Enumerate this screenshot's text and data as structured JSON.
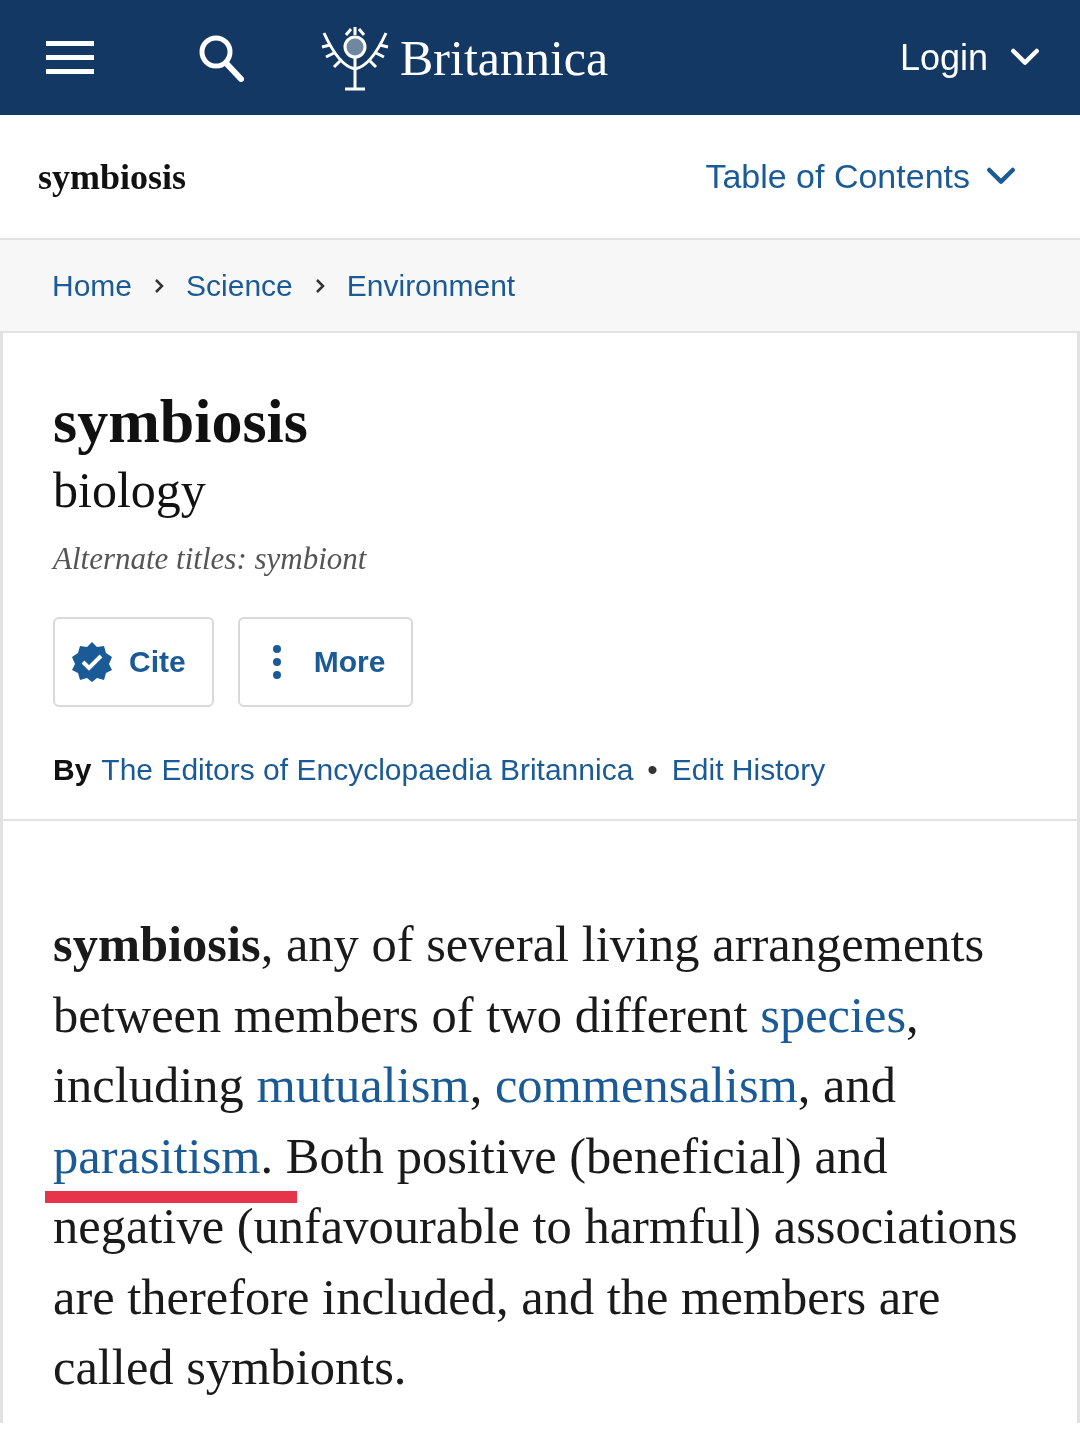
{
  "header": {
    "brand": "Britannica",
    "login": "Login"
  },
  "subheader": {
    "topic": "symbiosis",
    "toc": "Table of Contents"
  },
  "breadcrumbs": [
    "Home",
    "Science",
    "Environment"
  ],
  "article": {
    "title": "symbiosis",
    "subtitle": "biology",
    "alternate_titles": "Alternate titles: symbiont",
    "buttons": [
      {
        "kind": "cite",
        "label": "Cite"
      },
      {
        "kind": "more",
        "label": "More"
      }
    ],
    "byline": {
      "by": "By",
      "author": "The Editors of Encyclopaedia Britannica",
      "separator": "•",
      "history": "Edit History"
    },
    "paragraph": [
      {
        "kind": "bold",
        "text": "symbiosis"
      },
      {
        "kind": "plain",
        "text": ", any of several living arrangements between members of two different "
      },
      {
        "kind": "link",
        "text": "species",
        "underlined": false
      },
      {
        "kind": "plain",
        "text": ", including "
      },
      {
        "kind": "link",
        "text": "mutualism",
        "underlined": false
      },
      {
        "kind": "plain",
        "text": ", "
      },
      {
        "kind": "link",
        "text": "commensalism",
        "underlined": false
      },
      {
        "kind": "plain",
        "text": ", and "
      },
      {
        "kind": "link",
        "text": "parasitism",
        "underlined": true
      },
      {
        "kind": "plain",
        "text": ". Both positive (beneficial) and negative (unfavourable to harmful) associations are therefore included, and the members are called symbionts."
      }
    ]
  }
}
